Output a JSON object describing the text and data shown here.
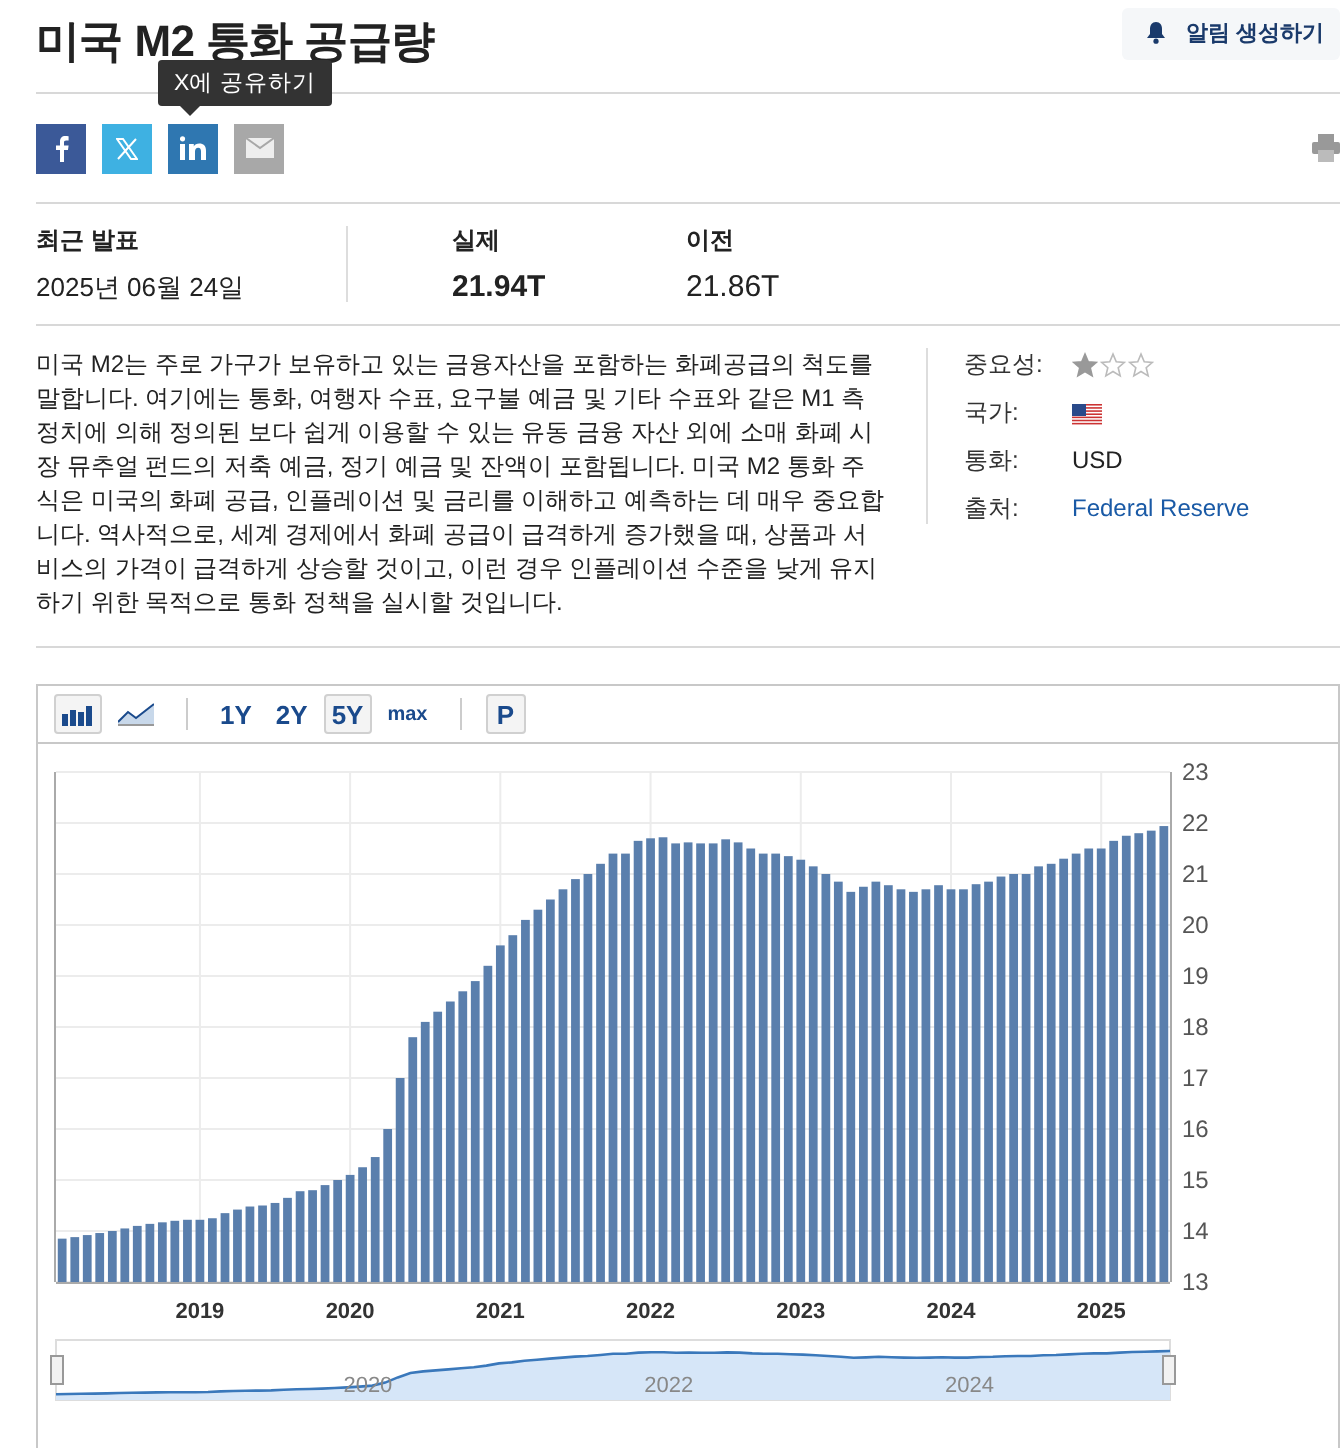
{
  "header": {
    "title": "미국 M2 통화 공급량",
    "alert_button": "알림 생성하기"
  },
  "share": {
    "tooltip": "X에 공유하기",
    "buttons": [
      {
        "kind": "facebook"
      },
      {
        "kind": "x"
      },
      {
        "kind": "linkedin"
      },
      {
        "kind": "email"
      }
    ]
  },
  "release": {
    "latest_label": "최근 발표",
    "latest_date": "2025년 06월 24일",
    "actual_label": "실제",
    "actual_value": "21.94T",
    "previous_label": "이전",
    "previous_value": "21.86T"
  },
  "description": "미국 M2는 주로 가구가 보유하고 있는 금융자산을 포함하는 화폐공급의 척도를 말합니다. 여기에는 통화, 여행자 수표, 요구불 예금 및 기타 수표와 같은 M1 측정치에 의해 정의된 보다 쉽게 이용할 수 있는 유동 금융 자산 외에 소매 화폐 시장 뮤추얼 펀드의 저축 예금, 정기 예금 및 잔액이 포함됩니다. 미국 M2 통화 주식은 미국의 화폐 공급, 인플레이션 및 금리를 이해하고 예측하는 데 매우 중요합니다. 역사적으로, 세계 경제에서 화폐 공급이 급격하게 증가했을 때, 상품과 서비스의 가격이 급격하게 상승할 것이고, 이런 경우 인플레이션 수준을 낮게 유지하기 위한 목적으로 통화 정책을 실시할 것입니다.",
  "details": [
    {
      "kind": "stars",
      "label": "중요성:",
      "stars": 1
    },
    {
      "kind": "flag",
      "label": "국가:"
    },
    {
      "kind": "text",
      "label": "통화:",
      "value": "USD"
    },
    {
      "kind": "link",
      "label": "출처:",
      "value": "Federal Reserve"
    }
  ],
  "chart": {
    "chart_types": [
      {
        "kind": "bar",
        "selected": true
      },
      {
        "kind": "area",
        "selected": false
      }
    ],
    "ranges": [
      {
        "label": "1Y",
        "selected": false
      },
      {
        "label": "2Y",
        "selected": false
      },
      {
        "label": "5Y",
        "selected": true
      },
      {
        "label": "max",
        "selected": false
      }
    ],
    "period_button": "P",
    "chart_data": {
      "type": "bar",
      "grid": true,
      "x": [
        2018.083,
        2018.167,
        2018.25,
        2018.333,
        2018.417,
        2018.5,
        2018.583,
        2018.667,
        2018.75,
        2018.833,
        2018.917,
        2019,
        2019.083,
        2019.167,
        2019.25,
        2019.333,
        2019.417,
        2019.5,
        2019.583,
        2019.667,
        2019.75,
        2019.833,
        2019.917,
        2020,
        2020.083,
        2020.167,
        2020.25,
        2020.333,
        2020.417,
        2020.5,
        2020.583,
        2020.667,
        2020.75,
        2020.833,
        2020.917,
        2021,
        2021.083,
        2021.167,
        2021.25,
        2021.333,
        2021.417,
        2021.5,
        2021.583,
        2021.667,
        2021.75,
        2021.833,
        2021.917,
        2022,
        2022.083,
        2022.167,
        2022.25,
        2022.333,
        2022.417,
        2022.5,
        2022.583,
        2022.667,
        2022.75,
        2022.833,
        2022.917,
        2023,
        2023.083,
        2023.167,
        2023.25,
        2023.333,
        2023.417,
        2023.5,
        2023.583,
        2023.667,
        2023.75,
        2023.833,
        2023.917,
        2024,
        2024.083,
        2024.167,
        2024.25,
        2024.333,
        2024.417,
        2024.5,
        2024.583,
        2024.667,
        2024.75,
        2024.833,
        2024.917,
        2025,
        2025.083,
        2025.167,
        2025.25,
        2025.333,
        2025.417
      ],
      "values": [
        13.85,
        13.88,
        13.92,
        13.96,
        14.0,
        14.05,
        14.1,
        14.14,
        14.17,
        14.2,
        14.22,
        14.22,
        14.25,
        14.35,
        14.42,
        14.48,
        14.5,
        14.55,
        14.65,
        14.78,
        14.8,
        14.9,
        15.0,
        15.1,
        15.25,
        15.45,
        16.0,
        17.0,
        17.8,
        18.1,
        18.3,
        18.5,
        18.7,
        18.9,
        19.2,
        19.6,
        19.8,
        20.1,
        20.3,
        20.5,
        20.7,
        20.9,
        21.0,
        21.2,
        21.4,
        21.4,
        21.65,
        21.7,
        21.72,
        21.6,
        21.62,
        21.6,
        21.6,
        21.68,
        21.62,
        21.5,
        21.4,
        21.4,
        21.35,
        21.28,
        21.15,
        21.0,
        20.85,
        20.65,
        20.75,
        20.85,
        20.78,
        20.7,
        20.65,
        20.7,
        20.78,
        20.7,
        20.7,
        20.8,
        20.85,
        20.95,
        21.0,
        21.0,
        21.15,
        21.2,
        21.3,
        21.4,
        21.5,
        21.5,
        21.65,
        21.75,
        21.8,
        21.85,
        21.94
      ],
      "xlim": [
        2018.042,
        2025.458
      ],
      "ylim": [
        13,
        23
      ],
      "yticks": [
        13,
        14,
        15,
        16,
        17,
        18,
        19,
        20,
        21,
        22,
        23
      ],
      "xticks": [
        2019,
        2020,
        2021,
        2022,
        2023,
        2024,
        2025
      ]
    },
    "navigator": {
      "labels": [
        "2020",
        "2022",
        "2024"
      ]
    }
  }
}
